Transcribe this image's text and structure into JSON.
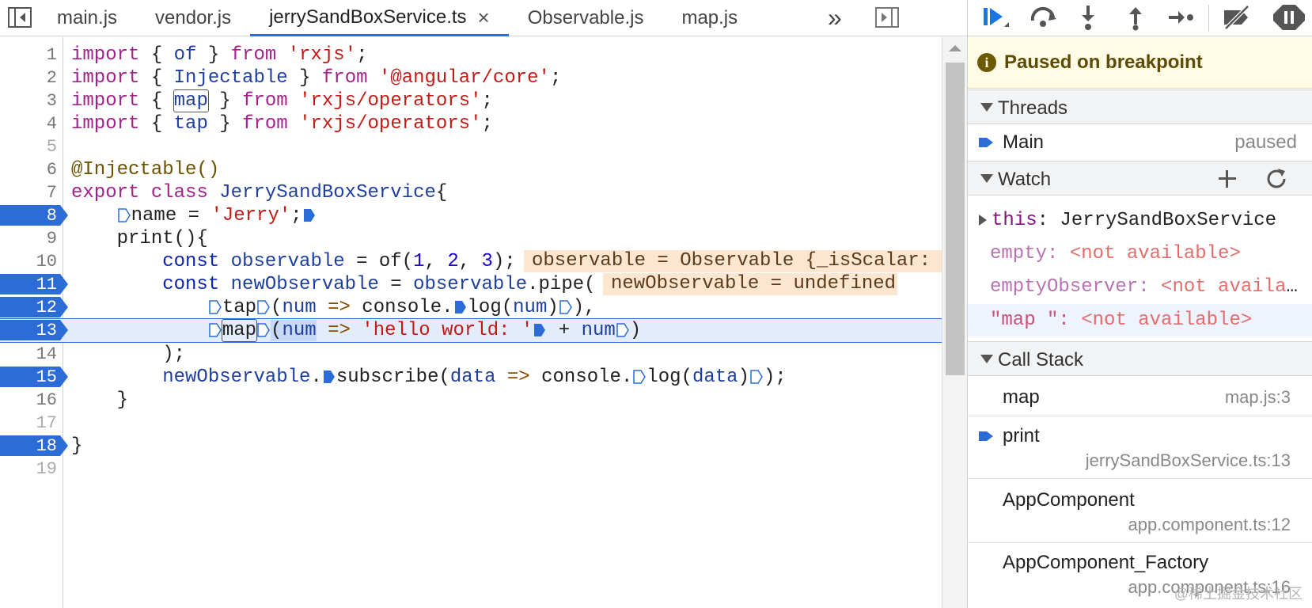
{
  "editor": {
    "tabs": [
      {
        "label": "main.js"
      },
      {
        "label": "vendor.js"
      },
      {
        "label": "jerrySandBoxService.ts",
        "close": "×"
      },
      {
        "label": "Observable.js"
      },
      {
        "label": "map.js"
      }
    ],
    "more_tabs": "»",
    "lines": [
      {
        "n": "1"
      },
      {
        "n": "2"
      },
      {
        "n": "3"
      },
      {
        "n": "4"
      },
      {
        "n": "5"
      },
      {
        "n": "6"
      },
      {
        "n": "7"
      },
      {
        "n": "8"
      },
      {
        "n": "9"
      },
      {
        "n": "10"
      },
      {
        "n": "11"
      },
      {
        "n": "12"
      },
      {
        "n": "13"
      },
      {
        "n": "14"
      },
      {
        "n": "15"
      },
      {
        "n": "16"
      },
      {
        "n": "17"
      },
      {
        "n": "18"
      },
      {
        "n": "19"
      }
    ],
    "code": {
      "l1": {
        "a": "import",
        "b": " { ",
        "c": "of",
        "d": " } ",
        "e": "from",
        "f": " ",
        "g": "'rxjs'",
        "h": ";"
      },
      "l2": {
        "a": "import",
        "b": " { ",
        "c": "Injectable",
        "d": " } ",
        "e": "from",
        "f": " ",
        "g": "'@angular/core'",
        "h": ";"
      },
      "l3": {
        "a": "import",
        "b": " { ",
        "c": "map",
        "d": " } ",
        "e": "from",
        "f": " ",
        "g": "'rxjs/operators'",
        "h": ";"
      },
      "l4": {
        "a": "import",
        "b": " { ",
        "c": "tap",
        "d": " } ",
        "e": "from",
        "f": " ",
        "g": "'rxjs/operators'",
        "h": ";"
      },
      "l6": {
        "a": "@Injectable()"
      },
      "l7": {
        "a": "export",
        "b": " ",
        "c": "class",
        "d": " ",
        "e": "JerrySandBoxService",
        "f": "{"
      },
      "l8": {
        "a": "    ",
        "b": "name",
        "c": " = ",
        "d": "'Jerry'",
        "e": ";"
      },
      "l9": {
        "a": "    print(){"
      },
      "l10": {
        "a": "        ",
        "b": "const",
        "c": " ",
        "d": "observable",
        "e": " = of(",
        "f": "1",
        "g": ", ",
        "h": "2",
        "i": ", ",
        "j": "3",
        "k": ");"
      },
      "l11": {
        "a": "        ",
        "b": "const",
        "c": " ",
        "d": "newObservable",
        "e": " = ",
        "f": "observable",
        "g": ".pipe("
      },
      "l12": {
        "a": "            ",
        "b": "tap",
        "c": "(",
        "d": "num",
        "e": " ",
        "f": "=>",
        "g": " console.",
        "h": "log",
        "i": "(",
        "j": "num",
        "k": ")",
        "l": "),"
      },
      "l13": {
        "a": "            ",
        "b": "map",
        "c": "(",
        "d": "num",
        "e": " ",
        "f": "=>",
        "g": " ",
        "h": "'hello world: '",
        "i": " + ",
        "j": "num",
        "k": ")"
      },
      "l14": {
        "a": "        );"
      },
      "l15": {
        "a": "        ",
        "b": "newObservable",
        "c": ".",
        "d": "subscribe",
        "e": "(",
        "f": "data",
        "g": " ",
        "h": "=>",
        "i": " console.",
        "j": "log",
        "k": "(",
        "l": "data",
        "m": ")",
        "n": ");"
      },
      "l16": {
        "a": "    }"
      },
      "l18": {
        "a": "}"
      }
    },
    "inline_values": {
      "l10": "observable = Observable {_isScalar:",
      "l11": "newObservable = undefined"
    },
    "breakpoint_lines": [
      "8",
      "11",
      "12",
      "13",
      "15",
      "18"
    ],
    "current_line": "13"
  },
  "debugger": {
    "paused_text": "Paused on breakpoint",
    "threads": {
      "label": "Threads",
      "items": [
        {
          "name": "Main",
          "state": "paused"
        }
      ]
    },
    "watch": {
      "label": "Watch",
      "items": [
        {
          "name": "this",
          "sep": ": ",
          "value": "JerrySandBoxService"
        },
        {
          "name": "empty",
          "sep": ": ",
          "value": "<not available>"
        },
        {
          "name": "emptyObserver",
          "sep": ": ",
          "value": "<not available>"
        },
        {
          "name": "\"map \"",
          "sep": ": ",
          "value": "<not available>"
        }
      ]
    },
    "call_stack": {
      "label": "Call Stack",
      "frames": [
        {
          "name": "map",
          "location": "map.js:3"
        },
        {
          "name": "print",
          "location": "jerrySandBoxService.ts:13"
        },
        {
          "name": "AppComponent",
          "location": "app.component.ts:12"
        },
        {
          "name": "AppComponent_Factory",
          "location": "app.component.ts:16"
        }
      ]
    }
  },
  "watermark": "@稀土掘金技术社区",
  "colors": {
    "breakpoint_blue": "#2b6cd6",
    "current_line_bg": "#e3ecfb",
    "paused_banner_bg": "#fffbe5",
    "inline_value_bg": "#fde6cf"
  }
}
